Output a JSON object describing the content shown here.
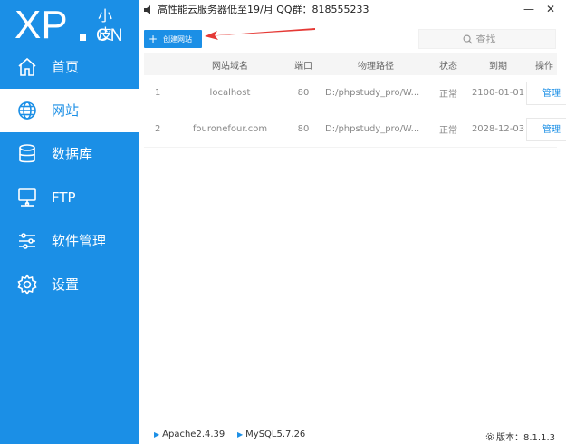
{
  "logo": {
    "main": "XP",
    "top": "小皮",
    "bottom": "CN"
  },
  "nav": [
    {
      "label": "首页",
      "icon": "home-icon"
    },
    {
      "label": "网站",
      "icon": "globe-icon",
      "active": true
    },
    {
      "label": "数据库",
      "icon": "database-icon"
    },
    {
      "label": "FTP",
      "icon": "server-icon"
    },
    {
      "label": "软件管理",
      "icon": "sliders-icon"
    },
    {
      "label": "设置",
      "icon": "gear-icon"
    }
  ],
  "notice": {
    "text": "高性能云服务器低至19/月  QQ群：818555233"
  },
  "window": {
    "minimize": "—",
    "close": "✕"
  },
  "toolbar": {
    "create_label": "创建网站",
    "search_placeholder": "查找"
  },
  "table": {
    "headers": [
      "",
      "网站域名",
      "端口",
      "物理路径",
      "状态",
      "到期",
      "操作"
    ],
    "rows": [
      {
        "idx": "1",
        "domain": "localhost",
        "port": "80",
        "path": "D:/phpstudy_pro/W...",
        "status": "正常",
        "expiry": "2100-01-01",
        "action": "管理"
      },
      {
        "idx": "2",
        "domain": "fouronefour.com",
        "port": "80",
        "path": "D:/phpstudy_pro/W...",
        "status": "正常",
        "expiry": "2028-12-03",
        "action": "管理"
      }
    ]
  },
  "footer": {
    "apache": "Apache2.4.39",
    "mysql": "MySQL5.7.26",
    "version": "版本：8.1.1.3"
  },
  "colors": {
    "accent": "#1b8fe6",
    "arrow": "#e53935"
  }
}
